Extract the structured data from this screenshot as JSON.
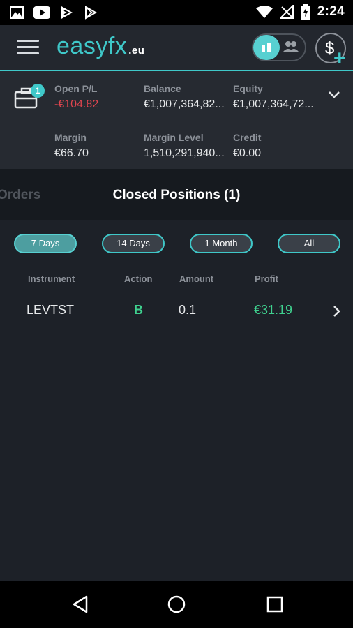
{
  "status_bar": {
    "time": "2:24",
    "icons": [
      "image-icon",
      "youtube-icon",
      "play-store-icon",
      "play-store-outline-icon",
      "wifi-icon",
      "no-signal-icon",
      "battery-charging-icon"
    ]
  },
  "header": {
    "logo_text": "easyfx",
    "logo_suffix": ".eu",
    "menu_icon": "hamburger-icon",
    "mode_toggle_icons": [
      "single-trader-icon",
      "social-traders-icon"
    ],
    "deposit_icon": "dollar-plus-icon"
  },
  "summary": {
    "badge": "1",
    "open_pl": {
      "label": "Open P/L",
      "value": "-€104.82"
    },
    "balance": {
      "label": "Balance",
      "value": "€1,007,364,82..."
    },
    "equity": {
      "label": "Equity",
      "value": "€1,007,364,72..."
    },
    "margin": {
      "label": "Margin",
      "value": "€66.70"
    },
    "margin_level": {
      "label": "Margin Level",
      "value": "1,510,291,940..."
    },
    "credit": {
      "label": "Credit",
      "value": "€0.00"
    }
  },
  "tabs": {
    "orders": "Orders",
    "closed_positions": "Closed Positions (1)"
  },
  "filters": [
    "7 Days",
    "14 Days",
    "1 Month",
    "All"
  ],
  "table": {
    "columns": [
      "Instrument",
      "Action",
      "Amount",
      "Profit"
    ],
    "rows": [
      {
        "instrument": "LEVTST",
        "action": "B",
        "amount": "0.1",
        "profit": "€31.19"
      }
    ]
  },
  "colors": {
    "accent": "#3fc8c9",
    "negative": "#e0454f",
    "positive": "#3fd18f"
  }
}
